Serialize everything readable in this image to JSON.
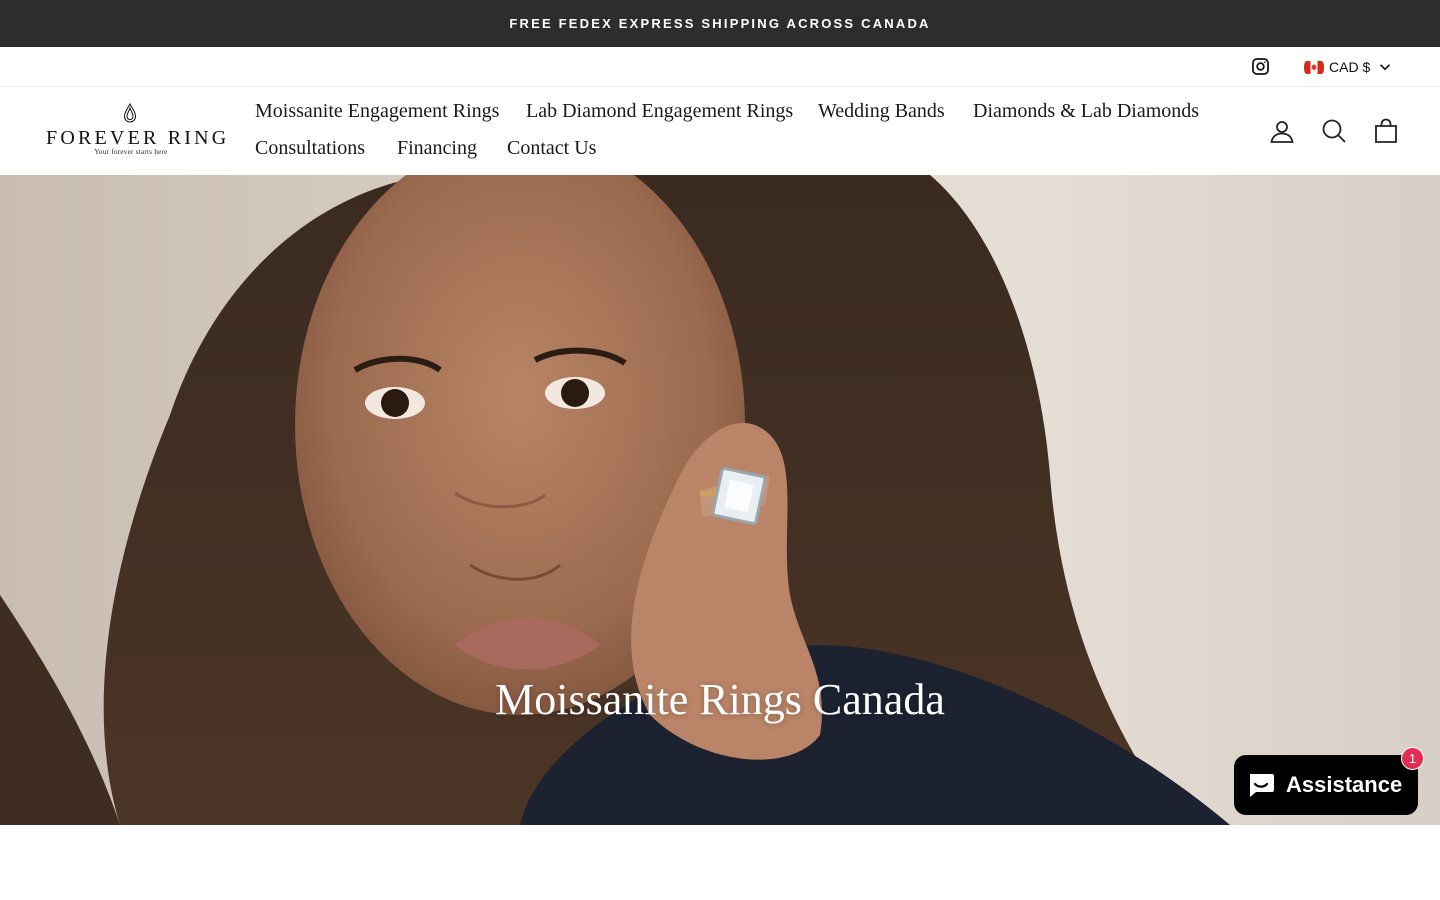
{
  "announcement": {
    "text": "FREE FEDEX EXPRESS SHIPPING ACROSS CANADA"
  },
  "utility": {
    "instagram_icon": "instagram-icon",
    "currency_label": "CAD $",
    "flag_icon": "canada-flag-icon"
  },
  "brand": {
    "name": "FOREVER RING",
    "tagline": "Your forever starts here"
  },
  "nav": {
    "items": [
      {
        "label": "Moissanite Engagement Rings"
      },
      {
        "label": "Lab Diamond Engagement Rings"
      },
      {
        "label": "Wedding Bands"
      },
      {
        "label": "Diamonds & Lab Diamonds"
      },
      {
        "label": "Consultations"
      },
      {
        "label": "Financing"
      },
      {
        "label": "Contact Us"
      }
    ]
  },
  "header_icons": [
    "account-icon",
    "search-icon",
    "cart-icon"
  ],
  "hero": {
    "title": "Moissanite Rings Canada"
  },
  "chat": {
    "label": "Assistance",
    "badge_count": "1"
  },
  "colors": {
    "announcement_bg": "#2d2d2d",
    "chat_badge": "#e42c52",
    "hero_text": "#ffffff"
  }
}
